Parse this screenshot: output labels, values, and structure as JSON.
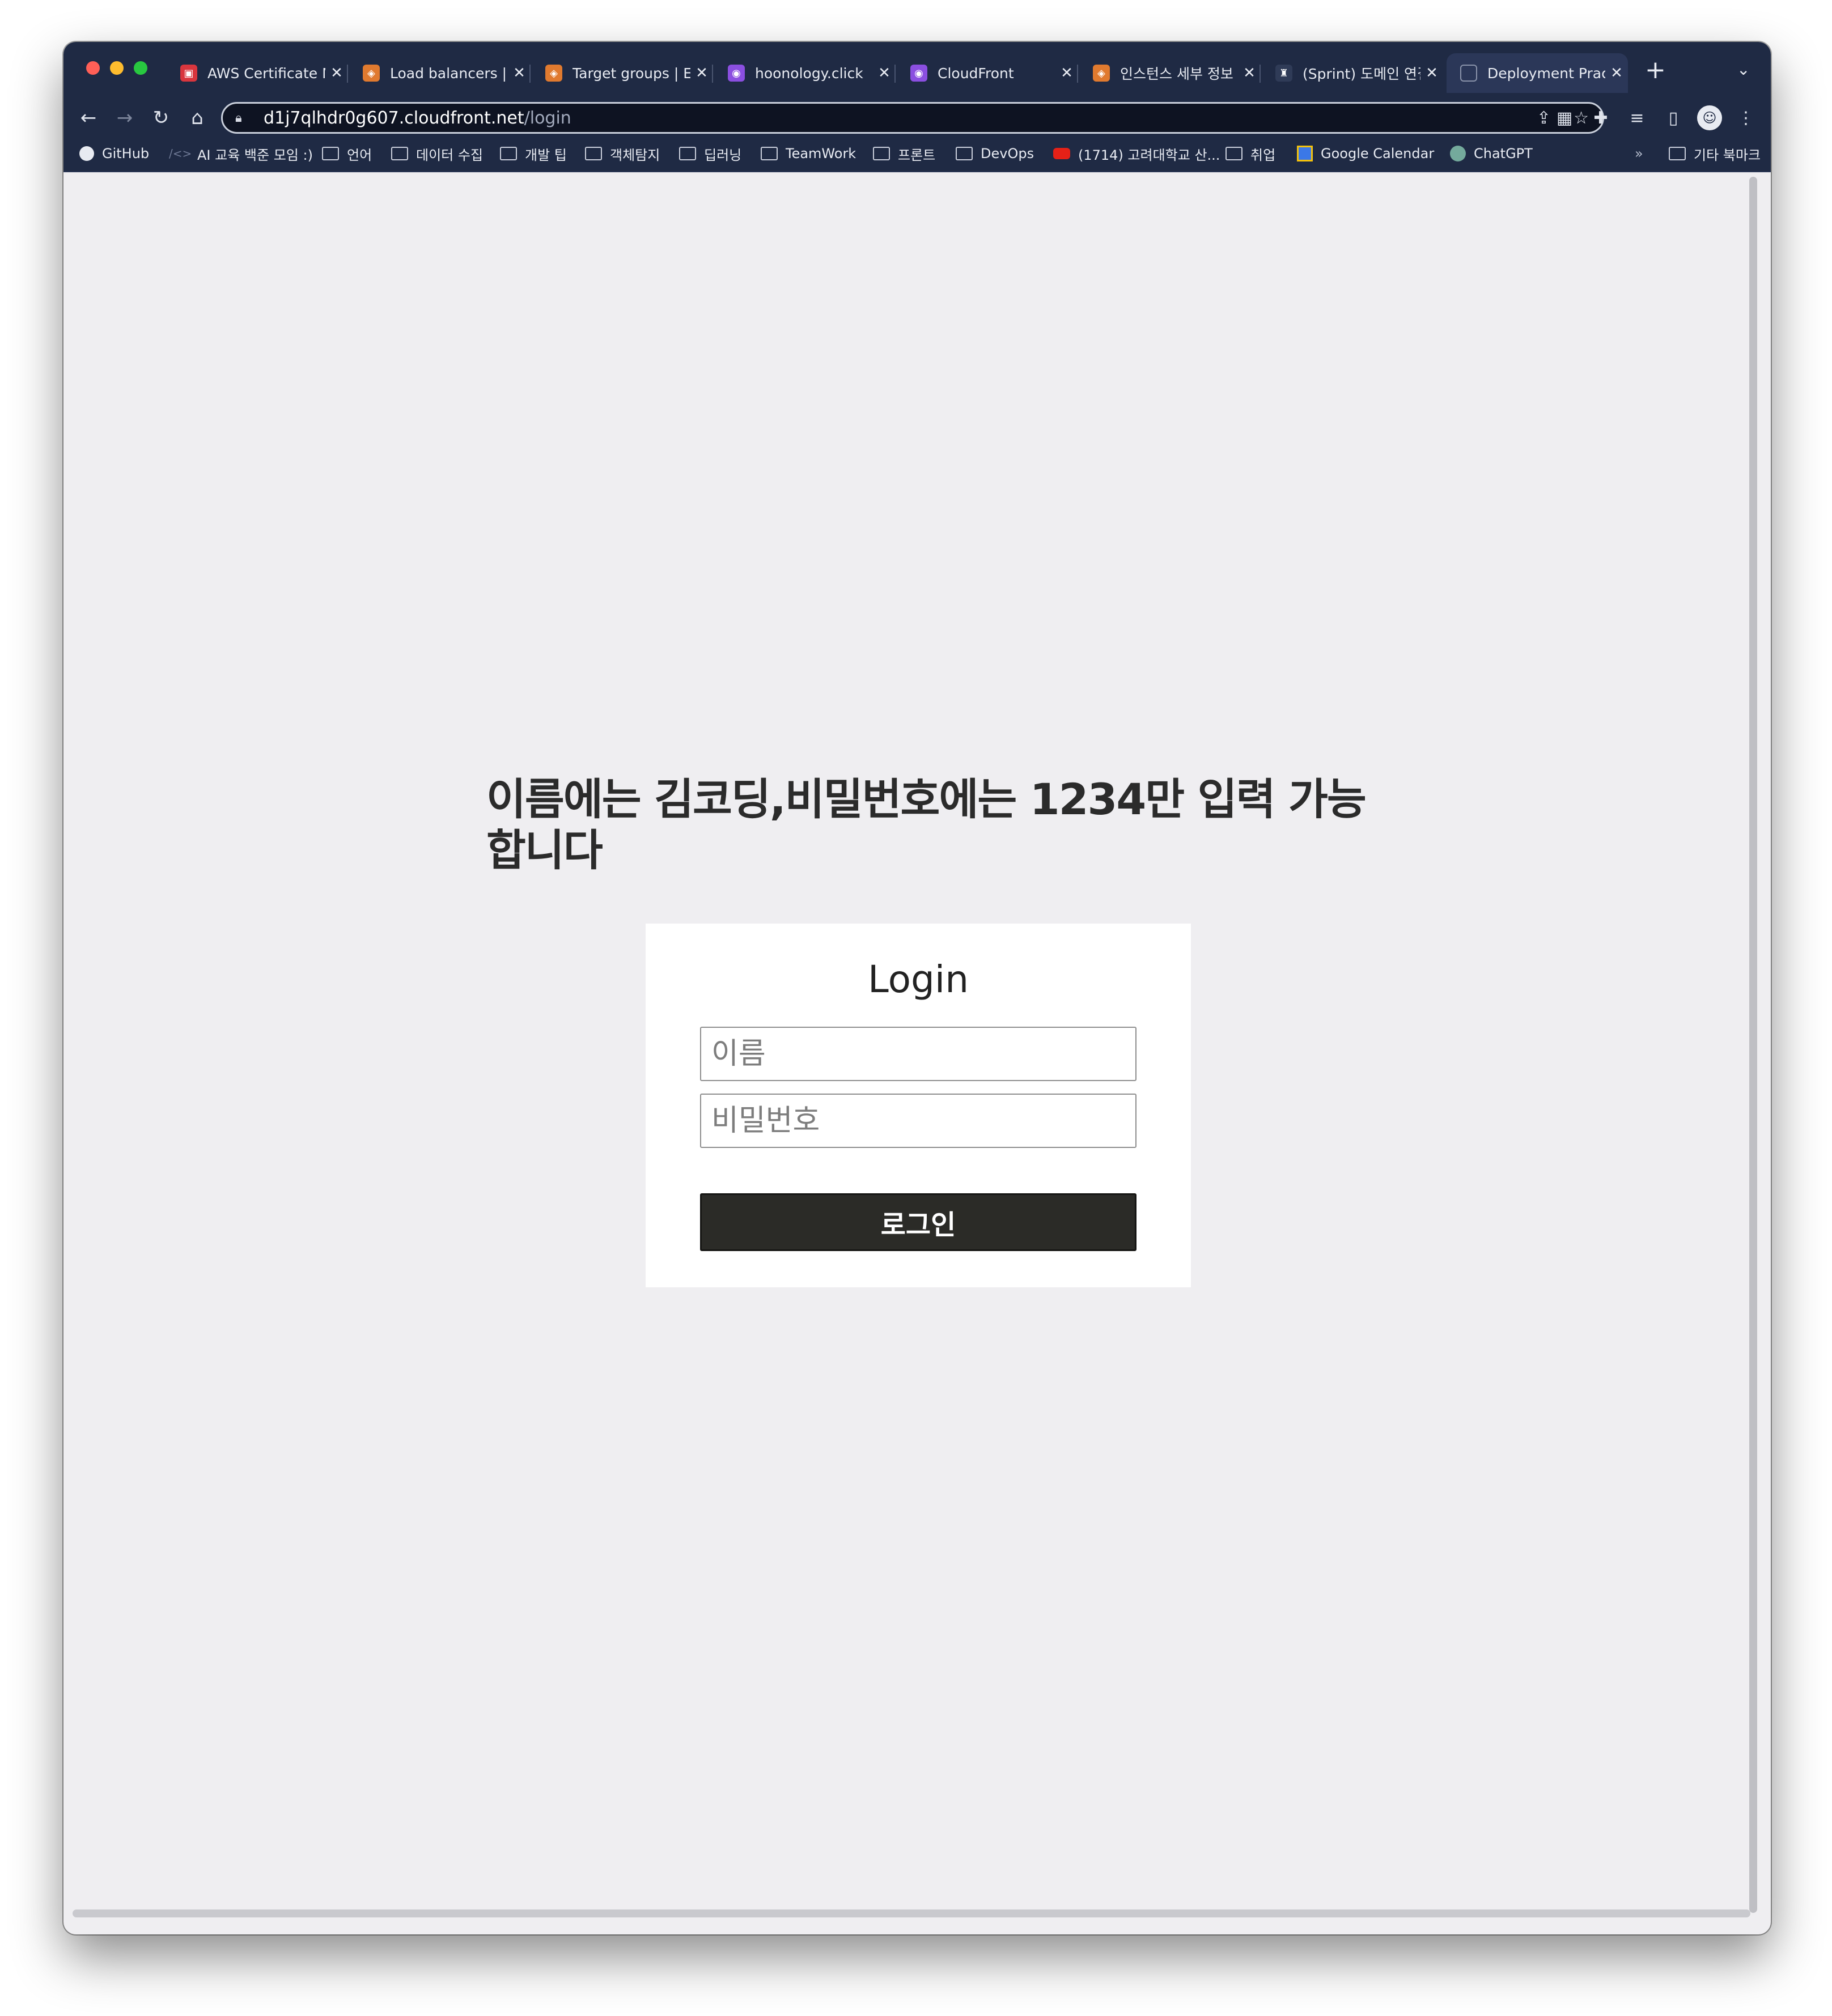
{
  "browser": {
    "tabs": [
      {
        "title": "AWS Certificate M",
        "icon": "aws-certificate-icon",
        "color": "#d9363e",
        "active": false
      },
      {
        "title": "Load balancers | E",
        "icon": "ec2-icon",
        "color": "#e07a2f",
        "active": false
      },
      {
        "title": "Target groups | EC",
        "icon": "ec2-icon",
        "color": "#e07a2f",
        "active": false
      },
      {
        "title": "hoonology.click",
        "icon": "route53-icon",
        "color": "#8b4fe0",
        "active": false
      },
      {
        "title": "CloudFront",
        "icon": "cloudfront-icon",
        "color": "#8b4fe0",
        "active": false
      },
      {
        "title": "인스턴스 세부 정보 |",
        "icon": "ec2-icon",
        "color": "#e07a2f",
        "active": false
      },
      {
        "title": "(Sprint) 도메인 연결",
        "icon": "sprint-icon",
        "color": "#2f3b57",
        "active": false
      },
      {
        "title": "Deployment Prac",
        "icon": "document-icon",
        "color": "#2b3758",
        "active": true
      }
    ],
    "url_host": "d1j7qlhdr0g607.cloudfront.net",
    "url_path": "/login",
    "bookmarks": [
      {
        "label": "GitHub",
        "icon": "github-icon"
      },
      {
        "label": "AI 교육 백준 모임 :)",
        "icon": "code-icon"
      },
      {
        "label": "언어",
        "icon": "folder-icon"
      },
      {
        "label": "데이터 수집",
        "icon": "folder-icon"
      },
      {
        "label": "개발 팁",
        "icon": "folder-icon"
      },
      {
        "label": "객체탐지",
        "icon": "folder-icon"
      },
      {
        "label": "딥러닝",
        "icon": "folder-icon"
      },
      {
        "label": "TeamWork",
        "icon": "folder-icon"
      },
      {
        "label": "프론트",
        "icon": "folder-icon"
      },
      {
        "label": "DevOps",
        "icon": "folder-icon"
      },
      {
        "label": "(1714) 고려대학교 산...",
        "icon": "youtube-icon"
      },
      {
        "label": "취업",
        "icon": "folder-icon"
      },
      {
        "label": "Google Calendar",
        "icon": "calendar-icon"
      },
      {
        "label": "ChatGPT",
        "icon": "chatgpt-icon"
      }
    ],
    "bookmarks_overflow": "»",
    "other_bookmarks": "기타 북마크"
  },
  "page": {
    "notice": "이름에는 김코딩,비밀번호에는 1234만 입력 가능합니다",
    "login": {
      "title": "Login",
      "name_placeholder": "이름",
      "name_value": "",
      "password_placeholder": "비밀번호",
      "password_value": "",
      "submit_label": "로그인"
    }
  },
  "colors": {
    "page_background": "#efeef1",
    "button_background": "#2b2b27",
    "browser_chrome": "#1f2a44"
  }
}
